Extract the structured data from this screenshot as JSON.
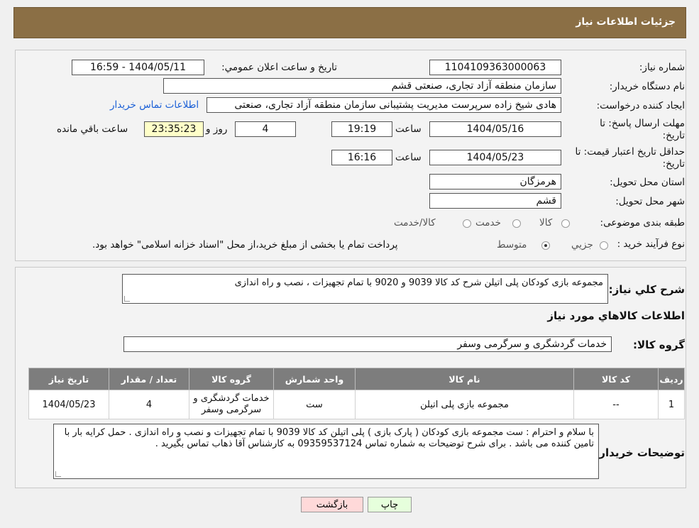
{
  "header": {
    "title": "جزئیات اطلاعات نیاز"
  },
  "form": {
    "need_number_label": "شماره نیاز:",
    "need_number": "1104109363000063",
    "announce_label": "تاریخ و ساعت اعلان عمومي:",
    "announce_value": "1404/05/11 - 16:59",
    "buyer_org_label": "نام دستگاه خریدار:",
    "buyer_org": "سازمان منطقه آزاد تجاری، صنعتی قشم",
    "creator_label": "ایجاد کننده درخواست:",
    "creator": "هادی شیخ زاده سرپرست مدیریت پشتیبانی سازمان منطقه آزاد تجاری، صنعتی",
    "contact_link": "اطلاعات تماس خریدار",
    "deadline_label": "مهلت ارسال پاسخ: تا تاریخ:",
    "deadline_date": "1404/05/16",
    "time_word": "ساعت",
    "deadline_time": "19:19",
    "days": "4",
    "days_word": "روز و",
    "remaining": "23:35:23",
    "remaining_word": "ساعت باقي مانده",
    "validity_label": "حداقل تاریخ اعتبار قیمت: تا تاریخ:",
    "validity_date": "1404/05/23",
    "validity_time": "16:16",
    "province_label": "استان محل تحویل:",
    "province": "هرمزگان",
    "city_label": "شهر محل تحویل:",
    "city": "قشم",
    "category_label": "طبقه بندی موضوعی:",
    "category_options": [
      "کالا",
      "خدمت",
      "کالا/خدمت"
    ],
    "process_label": "نوع فرآیند خرید :",
    "process_options": [
      "جزیي",
      "متوسط"
    ],
    "process_note": "پرداخت تمام یا بخشی از مبلغ خرید،از محل \"اسناد خزانه اسلامی\" خواهد بود."
  },
  "description": {
    "label": "شرح کلي نیاز:",
    "value": "مجموعه بازی کودکان پلی اتیلن شرح کد کالا 9039 و 9020 با تمام تجهیزات ، نصب و راه اندازی",
    "goods_info_title": "اطلاعات کالاهاي مورد نیاز",
    "group_label": "گروه کالا:",
    "group_value": "خدمات گردشگری و سرگرمی وسفر"
  },
  "table": {
    "headers": [
      "ردیف",
      "کد کالا",
      "نام کالا",
      "واحد شمارش",
      "گروه کالا",
      "تعداد / مقدار",
      "تاریخ نیاز"
    ],
    "rows": [
      [
        "1",
        "--",
        "مجموعه بازی پلی اتیلن",
        "ست",
        "خدمات گردشگری و سرگرمی وسفر",
        "4",
        "1404/05/23"
      ]
    ]
  },
  "buyer_notes": {
    "label": "توضیحات خریدار:",
    "value": "با سلام و احترام : ست  مجموعه بازی کودکان ( پارک بازی ) پلی اتیلن کد کالا 9039 با تمام تجهیزات و  نصب و راه اندازی  . حمل کرایه بار با تامین کننده می باشد  . برای شرح توضیحات به شماره تماس 09359537124 به کارشناس آقا ذهاب تماس بگیرید ."
  },
  "buttons": {
    "print": "چاپ",
    "back": "بازگشت"
  },
  "watermark": {
    "text": "AriaTender.neT"
  },
  "colors": {
    "header": "#8b6f45",
    "link": "#1a5fd6",
    "remaining_bg": "#ffffc8",
    "back_bg": "#ffd9d9",
    "print_bg": "#e6ffdc"
  }
}
